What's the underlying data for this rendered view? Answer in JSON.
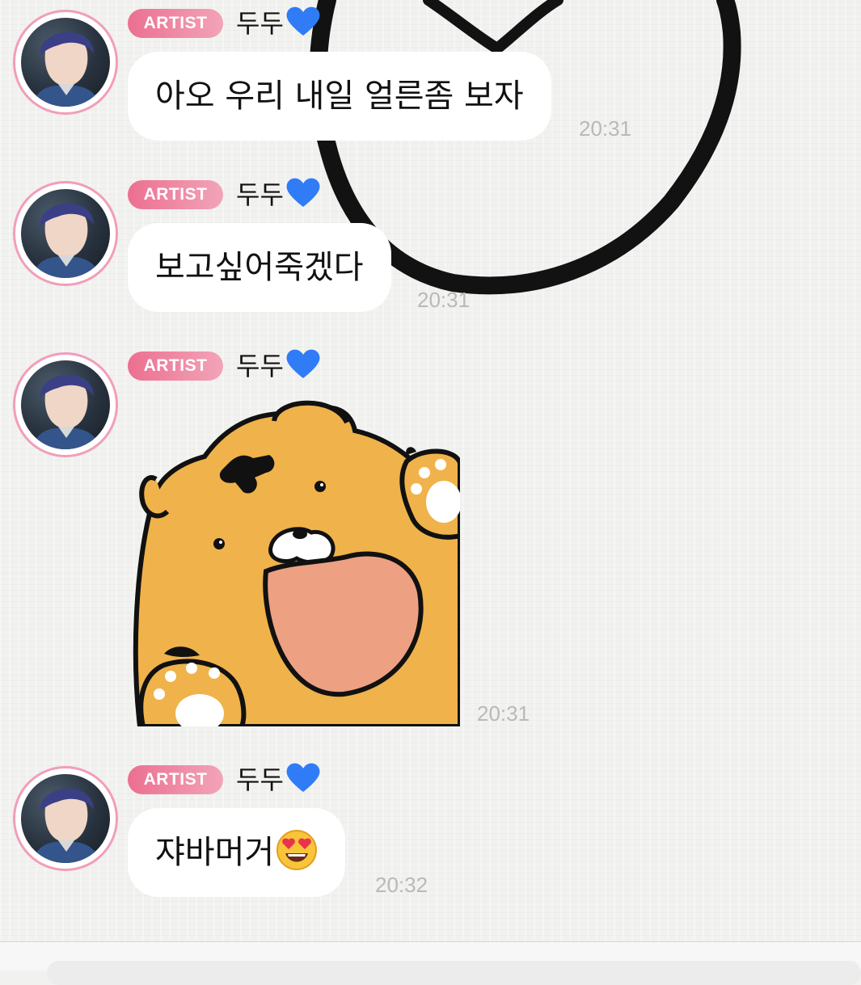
{
  "messages": [
    {
      "badge": "ARTIST",
      "name": "두두",
      "name_icon": "blue-heart-icon",
      "text": "아오 우리 내일 얼른좀 보자",
      "time": "20:31"
    },
    {
      "badge": "ARTIST",
      "name": "두두",
      "name_icon": "blue-heart-icon",
      "text": "보고싶어죽겠다",
      "time": "20:31"
    },
    {
      "badge": "ARTIST",
      "name": "두두",
      "name_icon": "blue-heart-icon",
      "sticker": "tiger-sticker",
      "time": "20:31"
    },
    {
      "badge": "ARTIST",
      "name": "두두",
      "name_icon": "blue-heart-icon",
      "text": "쟈바머거",
      "emoji": "heart-eyes-emoji-icon",
      "time": "20:32"
    }
  ],
  "colors": {
    "badge_start": "#ec6f90",
    "badge_end": "#f2a4b8",
    "avatar_ring": "#f29dba",
    "heart": "#2f7cf6",
    "bubble": "#ffffff",
    "time": "#b9b9b9",
    "background": "#f1f1ef"
  }
}
